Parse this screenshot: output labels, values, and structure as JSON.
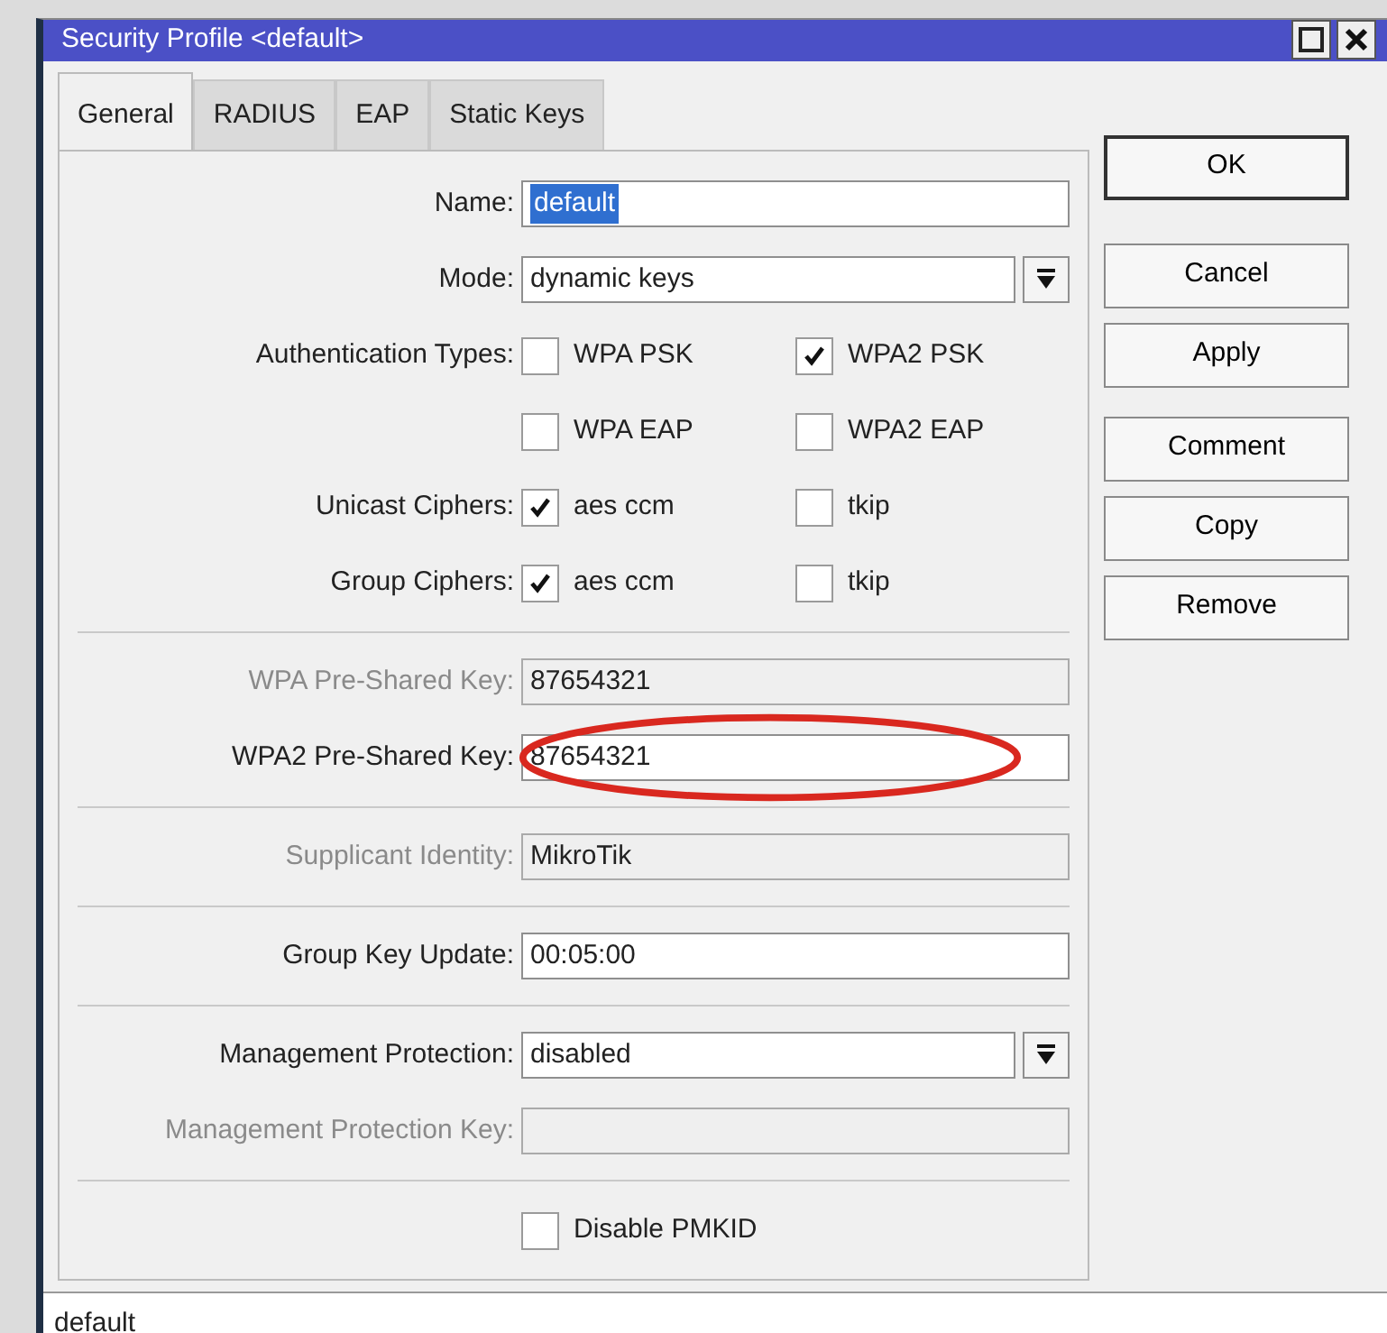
{
  "window": {
    "title": "Security Profile <default>"
  },
  "tabs": [
    {
      "label": "General",
      "selected": true
    },
    {
      "label": "RADIUS",
      "selected": false
    },
    {
      "label": "EAP",
      "selected": false
    },
    {
      "label": "Static Keys",
      "selected": false
    }
  ],
  "form": [
    {
      "kind": "text",
      "label": "Name:",
      "value": "default",
      "highlighted": true,
      "disabled": false
    },
    {
      "kind": "select",
      "label": "Mode:",
      "value": "dynamic keys",
      "disabled": false
    },
    {
      "kind": "checks",
      "label": "Authentication Types:",
      "options": [
        {
          "label": "WPA PSK",
          "checked": false
        },
        {
          "label": "WPA2 PSK",
          "checked": true
        }
      ]
    },
    {
      "kind": "checks",
      "options": [
        {
          "label": "WPA EAP",
          "checked": false
        },
        {
          "label": "WPA2 EAP",
          "checked": false
        }
      ]
    },
    {
      "kind": "checks",
      "label": "Unicast Ciphers:",
      "options": [
        {
          "label": "aes ccm",
          "checked": true
        },
        {
          "label": "tkip",
          "checked": false
        }
      ]
    },
    {
      "kind": "checks",
      "label": "Group Ciphers:",
      "options": [
        {
          "label": "aes ccm",
          "checked": true
        },
        {
          "label": "tkip",
          "checked": false
        }
      ]
    },
    {
      "kind": "separator"
    },
    {
      "kind": "text",
      "label": "WPA Pre-Shared Key:",
      "value": "87654321",
      "highlighted": false,
      "disabled": true
    },
    {
      "kind": "text",
      "label": "WPA2 Pre-Shared Key:",
      "value": "87654321",
      "highlighted": false,
      "disabled": false,
      "circled": true
    },
    {
      "kind": "separator"
    },
    {
      "kind": "text",
      "label": "Supplicant Identity:",
      "value": "MikroTik",
      "highlighted": false,
      "disabled": true
    },
    {
      "kind": "separator"
    },
    {
      "kind": "text",
      "label": "Group Key Update:",
      "value": "00:05:00",
      "highlighted": false,
      "disabled": false
    },
    {
      "kind": "separator"
    },
    {
      "kind": "select",
      "label": "Management Protection:",
      "value": "disabled",
      "disabled": false
    },
    {
      "kind": "text",
      "label": "Management Protection Key:",
      "highlighted": false,
      "disabled": true
    },
    {
      "kind": "separator"
    },
    {
      "kind": "checks",
      "options": [
        {
          "label": "Disable PMKID",
          "checked": false
        }
      ]
    }
  ],
  "buttons": [
    {
      "label": "OK",
      "default": true
    },
    {
      "label": "Cancel",
      "default": false
    },
    {
      "label": "Apply",
      "default": false
    },
    {
      "label": "Comment",
      "default": false
    },
    {
      "label": "Copy",
      "default": false
    },
    {
      "label": "Remove",
      "default": false
    }
  ],
  "status_bar": "default"
}
